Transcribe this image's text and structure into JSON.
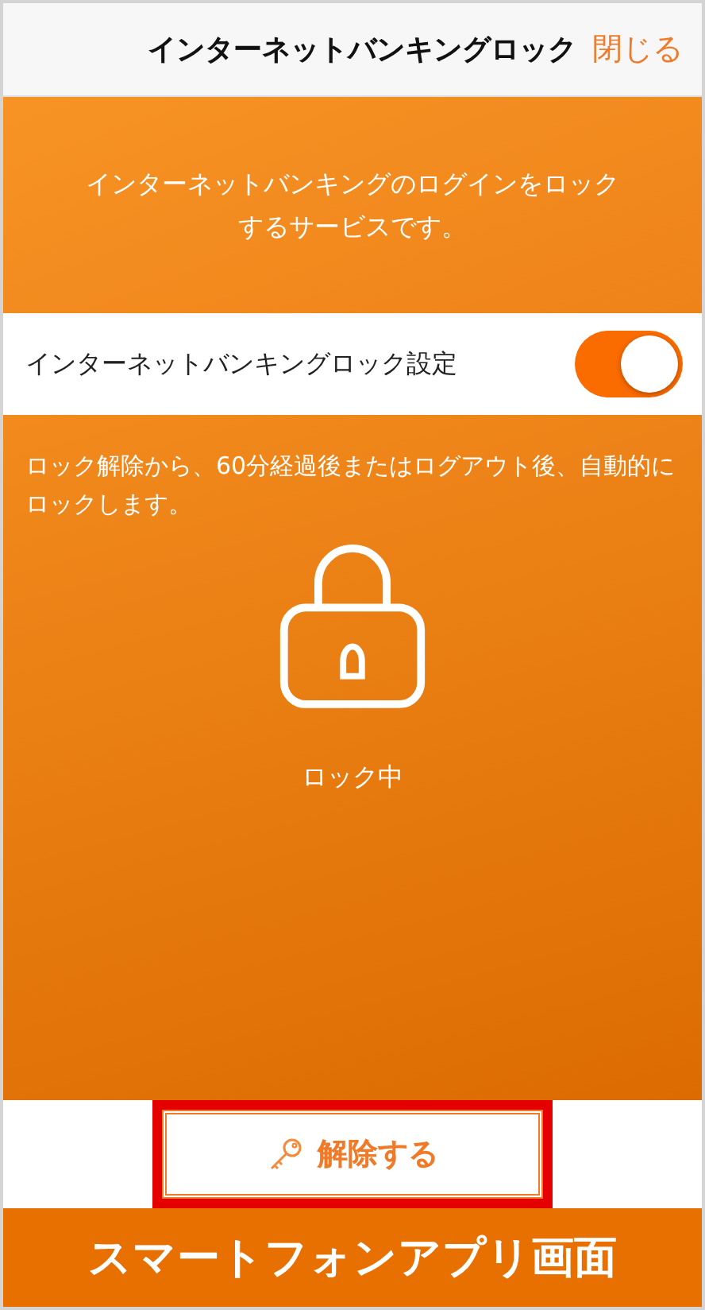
{
  "header": {
    "title": "インターネットバンキングロック",
    "close": "閉じる"
  },
  "intro": "インターネットバンキングのログインをロックするサービスです。",
  "setting": {
    "label": "インターネットバンキングロック設定",
    "on": true
  },
  "notice": "ロック解除から、60分経過後またはログアウト後、自動的にロックします。",
  "lock_status": {
    "locked": true,
    "label": "ロック中"
  },
  "unlock_button": {
    "label": "解除する",
    "highlighted": true
  },
  "banner": "スマートフォンアプリ画面"
}
